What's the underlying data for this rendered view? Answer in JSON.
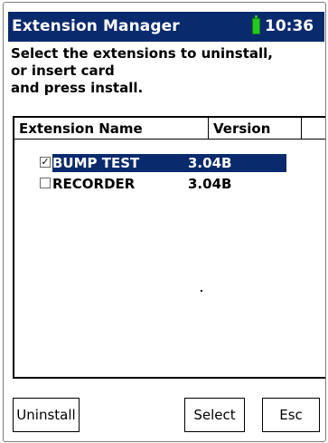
{
  "window": {
    "title": "Extension Manager",
    "time": "10:36",
    "battery_icon": "battery-full-icon",
    "titlebar_color": "#0a2a6e",
    "battery_color": "#23c81f"
  },
  "instructions": {
    "line1": "Select the extensions to uninstall,",
    "line2": "or insert card",
    "line3": "and press install."
  },
  "list": {
    "columns": [
      "Extension Name",
      "Version"
    ],
    "rows": [
      {
        "checked": true,
        "name": "BUMP TEST",
        "version": "3.04B",
        "selected": true
      },
      {
        "checked": false,
        "name": "RECORDER",
        "version": "3.04B",
        "selected": false
      }
    ],
    "selection_color": "#0a2a6e"
  },
  "buttons": {
    "uninstall": "Uninstall",
    "select": "Select",
    "esc": "Esc"
  }
}
